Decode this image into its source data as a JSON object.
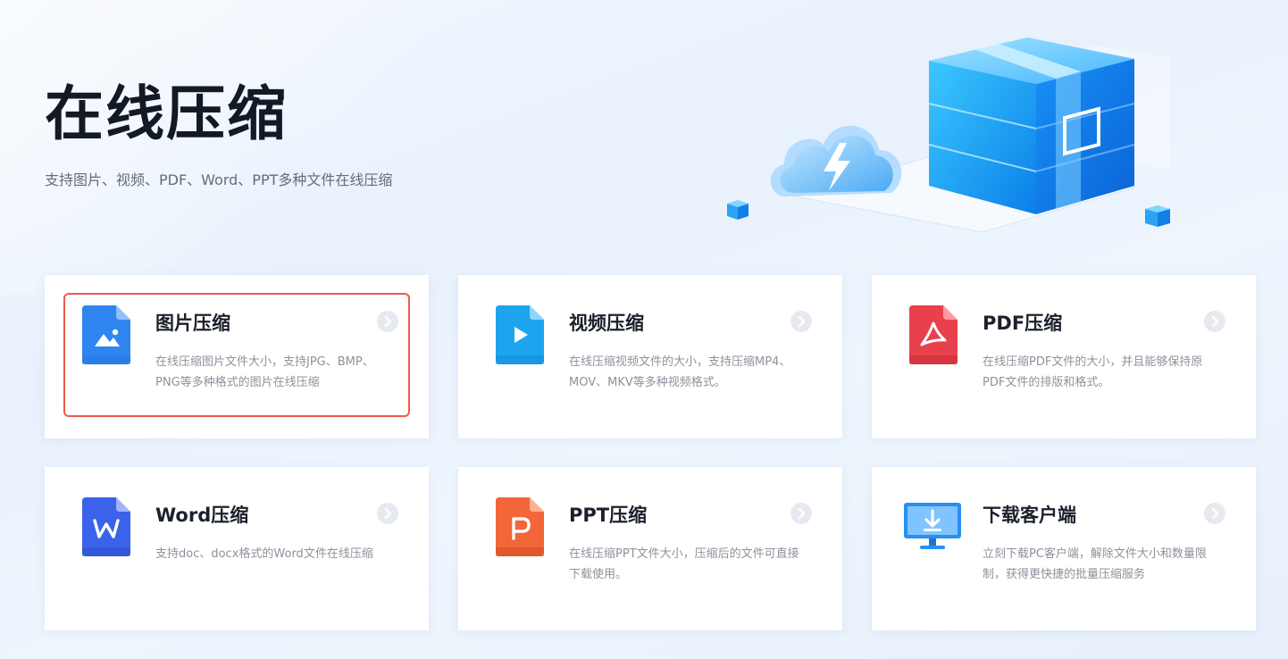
{
  "hero": {
    "title": "在线压缩",
    "subtitle": "支持图片、视频、PDF、Word、PPT多种文件在线压缩"
  },
  "cards": [
    {
      "title": "图片压缩",
      "desc": "在线压缩图片文件大小，支持JPG、BMP、PNG等多种格式的图片在线压缩",
      "icon": "image-file-icon",
      "color": "#2f86f0",
      "active": true
    },
    {
      "title": "视频压缩",
      "desc": "在线压缩视频文件的大小，支持压缩MP4、MOV、MKV等多种视频格式。",
      "icon": "video-file-icon",
      "color": "#1ea4ee",
      "active": false
    },
    {
      "title": "PDF压缩",
      "desc": "在线压缩PDF文件的大小，并且能够保持原PDF文件的排版和格式。",
      "icon": "pdf-file-icon",
      "color": "#e8404c",
      "active": false
    },
    {
      "title": "Word压缩",
      "desc": "支持doc、docx格式的Word文件在线压缩",
      "icon": "word-file-icon",
      "color": "#3a62ea",
      "active": false
    },
    {
      "title": "PPT压缩",
      "desc": "在线压缩PPT文件大小，压缩后的文件可直接下载使用。",
      "icon": "ppt-file-icon",
      "color": "#f2663a",
      "active": false
    },
    {
      "title": "下载客户端",
      "desc": "立刻下载PC客户端，解除文件大小和数量限制，获得更快捷的批量压缩服务",
      "icon": "monitor-download-icon",
      "color": "#2a8ff0",
      "active": false
    }
  ]
}
